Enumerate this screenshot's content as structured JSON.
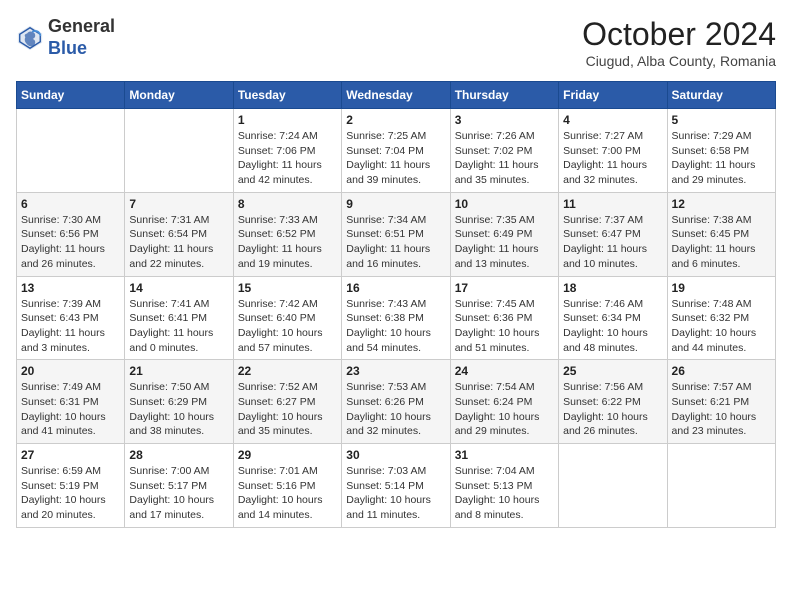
{
  "header": {
    "logo_general": "General",
    "logo_blue": "Blue",
    "month_title": "October 2024",
    "location": "Ciugud, Alba County, Romania"
  },
  "days_of_week": [
    "Sunday",
    "Monday",
    "Tuesday",
    "Wednesday",
    "Thursday",
    "Friday",
    "Saturday"
  ],
  "weeks": [
    [
      {
        "day": "",
        "info": ""
      },
      {
        "day": "",
        "info": ""
      },
      {
        "day": "1",
        "info": "Sunrise: 7:24 AM\nSunset: 7:06 PM\nDaylight: 11 hours and 42 minutes."
      },
      {
        "day": "2",
        "info": "Sunrise: 7:25 AM\nSunset: 7:04 PM\nDaylight: 11 hours and 39 minutes."
      },
      {
        "day": "3",
        "info": "Sunrise: 7:26 AM\nSunset: 7:02 PM\nDaylight: 11 hours and 35 minutes."
      },
      {
        "day": "4",
        "info": "Sunrise: 7:27 AM\nSunset: 7:00 PM\nDaylight: 11 hours and 32 minutes."
      },
      {
        "day": "5",
        "info": "Sunrise: 7:29 AM\nSunset: 6:58 PM\nDaylight: 11 hours and 29 minutes."
      }
    ],
    [
      {
        "day": "6",
        "info": "Sunrise: 7:30 AM\nSunset: 6:56 PM\nDaylight: 11 hours and 26 minutes."
      },
      {
        "day": "7",
        "info": "Sunrise: 7:31 AM\nSunset: 6:54 PM\nDaylight: 11 hours and 22 minutes."
      },
      {
        "day": "8",
        "info": "Sunrise: 7:33 AM\nSunset: 6:52 PM\nDaylight: 11 hours and 19 minutes."
      },
      {
        "day": "9",
        "info": "Sunrise: 7:34 AM\nSunset: 6:51 PM\nDaylight: 11 hours and 16 minutes."
      },
      {
        "day": "10",
        "info": "Sunrise: 7:35 AM\nSunset: 6:49 PM\nDaylight: 11 hours and 13 minutes."
      },
      {
        "day": "11",
        "info": "Sunrise: 7:37 AM\nSunset: 6:47 PM\nDaylight: 11 hours and 10 minutes."
      },
      {
        "day": "12",
        "info": "Sunrise: 7:38 AM\nSunset: 6:45 PM\nDaylight: 11 hours and 6 minutes."
      }
    ],
    [
      {
        "day": "13",
        "info": "Sunrise: 7:39 AM\nSunset: 6:43 PM\nDaylight: 11 hours and 3 minutes."
      },
      {
        "day": "14",
        "info": "Sunrise: 7:41 AM\nSunset: 6:41 PM\nDaylight: 11 hours and 0 minutes."
      },
      {
        "day": "15",
        "info": "Sunrise: 7:42 AM\nSunset: 6:40 PM\nDaylight: 10 hours and 57 minutes."
      },
      {
        "day": "16",
        "info": "Sunrise: 7:43 AM\nSunset: 6:38 PM\nDaylight: 10 hours and 54 minutes."
      },
      {
        "day": "17",
        "info": "Sunrise: 7:45 AM\nSunset: 6:36 PM\nDaylight: 10 hours and 51 minutes."
      },
      {
        "day": "18",
        "info": "Sunrise: 7:46 AM\nSunset: 6:34 PM\nDaylight: 10 hours and 48 minutes."
      },
      {
        "day": "19",
        "info": "Sunrise: 7:48 AM\nSunset: 6:32 PM\nDaylight: 10 hours and 44 minutes."
      }
    ],
    [
      {
        "day": "20",
        "info": "Sunrise: 7:49 AM\nSunset: 6:31 PM\nDaylight: 10 hours and 41 minutes."
      },
      {
        "day": "21",
        "info": "Sunrise: 7:50 AM\nSunset: 6:29 PM\nDaylight: 10 hours and 38 minutes."
      },
      {
        "day": "22",
        "info": "Sunrise: 7:52 AM\nSunset: 6:27 PM\nDaylight: 10 hours and 35 minutes."
      },
      {
        "day": "23",
        "info": "Sunrise: 7:53 AM\nSunset: 6:26 PM\nDaylight: 10 hours and 32 minutes."
      },
      {
        "day": "24",
        "info": "Sunrise: 7:54 AM\nSunset: 6:24 PM\nDaylight: 10 hours and 29 minutes."
      },
      {
        "day": "25",
        "info": "Sunrise: 7:56 AM\nSunset: 6:22 PM\nDaylight: 10 hours and 26 minutes."
      },
      {
        "day": "26",
        "info": "Sunrise: 7:57 AM\nSunset: 6:21 PM\nDaylight: 10 hours and 23 minutes."
      }
    ],
    [
      {
        "day": "27",
        "info": "Sunrise: 6:59 AM\nSunset: 5:19 PM\nDaylight: 10 hours and 20 minutes."
      },
      {
        "day": "28",
        "info": "Sunrise: 7:00 AM\nSunset: 5:17 PM\nDaylight: 10 hours and 17 minutes."
      },
      {
        "day": "29",
        "info": "Sunrise: 7:01 AM\nSunset: 5:16 PM\nDaylight: 10 hours and 14 minutes."
      },
      {
        "day": "30",
        "info": "Sunrise: 7:03 AM\nSunset: 5:14 PM\nDaylight: 10 hours and 11 minutes."
      },
      {
        "day": "31",
        "info": "Sunrise: 7:04 AM\nSunset: 5:13 PM\nDaylight: 10 hours and 8 minutes."
      },
      {
        "day": "",
        "info": ""
      },
      {
        "day": "",
        "info": ""
      }
    ]
  ]
}
